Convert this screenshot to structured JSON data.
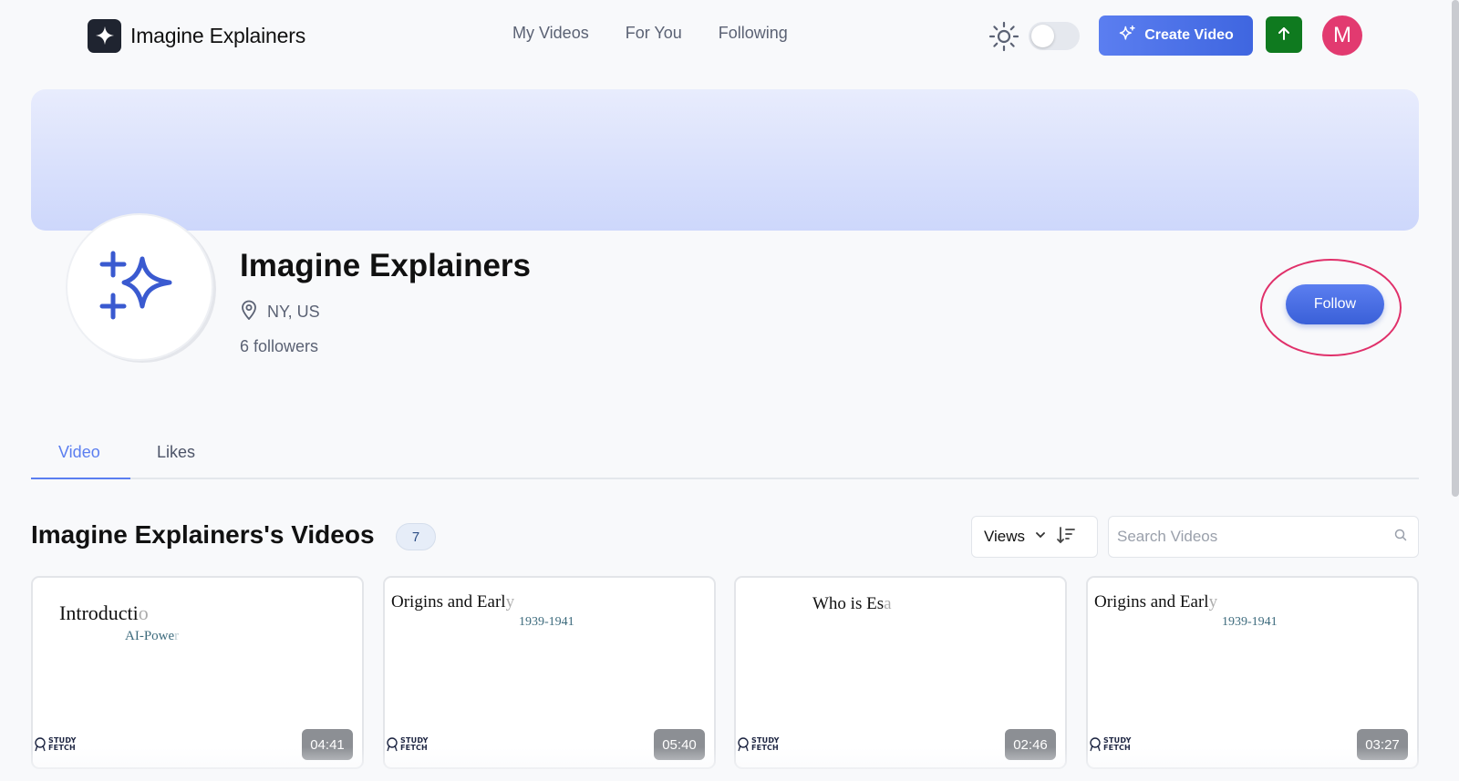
{
  "header": {
    "brand_name": "Imagine Explainers",
    "nav": [
      "My Videos",
      "For You",
      "Following"
    ],
    "create_label": "Create Video",
    "avatar_initial": "M"
  },
  "profile": {
    "name": "Imagine Explainers",
    "location": "NY, US",
    "followers": "6 followers",
    "follow_label": "Follow"
  },
  "tabs": [
    "Video",
    "Likes"
  ],
  "videos": {
    "title": "Imagine Explainers's Videos",
    "count": "7",
    "sort_label": "Views",
    "search_placeholder": "Search Videos",
    "cards": [
      {
        "title_a": "Introducti",
        "title_b": "o",
        "sub_a": "AI-Powe",
        "sub_b": "r",
        "duration": "04:41"
      },
      {
        "title_a": "Origins and Earl",
        "title_b": "y",
        "sub_a": "1939-1941",
        "sub_b": "",
        "duration": "05:40"
      },
      {
        "title_a": "Who is Es",
        "title_b": "a",
        "sub_a": "",
        "sub_b": "",
        "duration": "02:46"
      },
      {
        "title_a": "Origins and Earl",
        "title_b": "y",
        "sub_a": "1939-1941",
        "sub_b": "",
        "duration": "03:27"
      }
    ],
    "watermark": [
      "STUDY",
      "FETCH"
    ]
  },
  "colors": {
    "accent": "#5b7ef0",
    "upload_green": "#0f7a1f",
    "avatar_pink": "#e23a70",
    "highlight_ring": "#e0306a"
  },
  "icons": [
    "sparkle-logo-icon",
    "sun-icon",
    "sparkle-icon",
    "arrow-up-icon",
    "location-pin-icon",
    "chevron-down-icon",
    "sort-descending-icon",
    "search-icon",
    "study-fetch-logo-icon"
  ]
}
